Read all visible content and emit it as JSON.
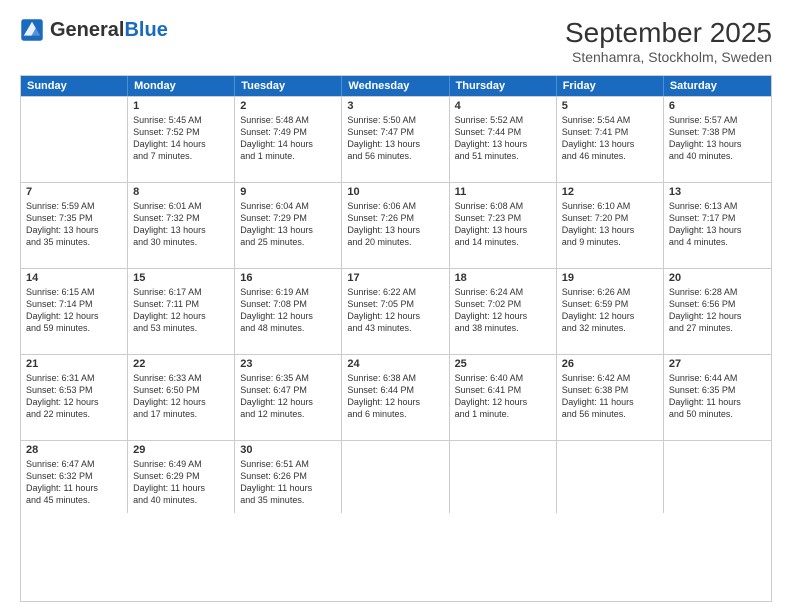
{
  "header": {
    "logo_line1": "General",
    "logo_line2": "Blue",
    "title": "September 2025",
    "subtitle": "Stenhamra, Stockholm, Sweden"
  },
  "weekdays": [
    "Sunday",
    "Monday",
    "Tuesday",
    "Wednesday",
    "Thursday",
    "Friday",
    "Saturday"
  ],
  "weeks": [
    [
      {
        "day": "",
        "lines": []
      },
      {
        "day": "1",
        "lines": [
          "Sunrise: 5:45 AM",
          "Sunset: 7:52 PM",
          "Daylight: 14 hours",
          "and 7 minutes."
        ]
      },
      {
        "day": "2",
        "lines": [
          "Sunrise: 5:48 AM",
          "Sunset: 7:49 PM",
          "Daylight: 14 hours",
          "and 1 minute."
        ]
      },
      {
        "day": "3",
        "lines": [
          "Sunrise: 5:50 AM",
          "Sunset: 7:47 PM",
          "Daylight: 13 hours",
          "and 56 minutes."
        ]
      },
      {
        "day": "4",
        "lines": [
          "Sunrise: 5:52 AM",
          "Sunset: 7:44 PM",
          "Daylight: 13 hours",
          "and 51 minutes."
        ]
      },
      {
        "day": "5",
        "lines": [
          "Sunrise: 5:54 AM",
          "Sunset: 7:41 PM",
          "Daylight: 13 hours",
          "and 46 minutes."
        ]
      },
      {
        "day": "6",
        "lines": [
          "Sunrise: 5:57 AM",
          "Sunset: 7:38 PM",
          "Daylight: 13 hours",
          "and 40 minutes."
        ]
      }
    ],
    [
      {
        "day": "7",
        "lines": [
          "Sunrise: 5:59 AM",
          "Sunset: 7:35 PM",
          "Daylight: 13 hours",
          "and 35 minutes."
        ]
      },
      {
        "day": "8",
        "lines": [
          "Sunrise: 6:01 AM",
          "Sunset: 7:32 PM",
          "Daylight: 13 hours",
          "and 30 minutes."
        ]
      },
      {
        "day": "9",
        "lines": [
          "Sunrise: 6:04 AM",
          "Sunset: 7:29 PM",
          "Daylight: 13 hours",
          "and 25 minutes."
        ]
      },
      {
        "day": "10",
        "lines": [
          "Sunrise: 6:06 AM",
          "Sunset: 7:26 PM",
          "Daylight: 13 hours",
          "and 20 minutes."
        ]
      },
      {
        "day": "11",
        "lines": [
          "Sunrise: 6:08 AM",
          "Sunset: 7:23 PM",
          "Daylight: 13 hours",
          "and 14 minutes."
        ]
      },
      {
        "day": "12",
        "lines": [
          "Sunrise: 6:10 AM",
          "Sunset: 7:20 PM",
          "Daylight: 13 hours",
          "and 9 minutes."
        ]
      },
      {
        "day": "13",
        "lines": [
          "Sunrise: 6:13 AM",
          "Sunset: 7:17 PM",
          "Daylight: 13 hours",
          "and 4 minutes."
        ]
      }
    ],
    [
      {
        "day": "14",
        "lines": [
          "Sunrise: 6:15 AM",
          "Sunset: 7:14 PM",
          "Daylight: 12 hours",
          "and 59 minutes."
        ]
      },
      {
        "day": "15",
        "lines": [
          "Sunrise: 6:17 AM",
          "Sunset: 7:11 PM",
          "Daylight: 12 hours",
          "and 53 minutes."
        ]
      },
      {
        "day": "16",
        "lines": [
          "Sunrise: 6:19 AM",
          "Sunset: 7:08 PM",
          "Daylight: 12 hours",
          "and 48 minutes."
        ]
      },
      {
        "day": "17",
        "lines": [
          "Sunrise: 6:22 AM",
          "Sunset: 7:05 PM",
          "Daylight: 12 hours",
          "and 43 minutes."
        ]
      },
      {
        "day": "18",
        "lines": [
          "Sunrise: 6:24 AM",
          "Sunset: 7:02 PM",
          "Daylight: 12 hours",
          "and 38 minutes."
        ]
      },
      {
        "day": "19",
        "lines": [
          "Sunrise: 6:26 AM",
          "Sunset: 6:59 PM",
          "Daylight: 12 hours",
          "and 32 minutes."
        ]
      },
      {
        "day": "20",
        "lines": [
          "Sunrise: 6:28 AM",
          "Sunset: 6:56 PM",
          "Daylight: 12 hours",
          "and 27 minutes."
        ]
      }
    ],
    [
      {
        "day": "21",
        "lines": [
          "Sunrise: 6:31 AM",
          "Sunset: 6:53 PM",
          "Daylight: 12 hours",
          "and 22 minutes."
        ]
      },
      {
        "day": "22",
        "lines": [
          "Sunrise: 6:33 AM",
          "Sunset: 6:50 PM",
          "Daylight: 12 hours",
          "and 17 minutes."
        ]
      },
      {
        "day": "23",
        "lines": [
          "Sunrise: 6:35 AM",
          "Sunset: 6:47 PM",
          "Daylight: 12 hours",
          "and 12 minutes."
        ]
      },
      {
        "day": "24",
        "lines": [
          "Sunrise: 6:38 AM",
          "Sunset: 6:44 PM",
          "Daylight: 12 hours",
          "and 6 minutes."
        ]
      },
      {
        "day": "25",
        "lines": [
          "Sunrise: 6:40 AM",
          "Sunset: 6:41 PM",
          "Daylight: 12 hours",
          "and 1 minute."
        ]
      },
      {
        "day": "26",
        "lines": [
          "Sunrise: 6:42 AM",
          "Sunset: 6:38 PM",
          "Daylight: 11 hours",
          "and 56 minutes."
        ]
      },
      {
        "day": "27",
        "lines": [
          "Sunrise: 6:44 AM",
          "Sunset: 6:35 PM",
          "Daylight: 11 hours",
          "and 50 minutes."
        ]
      }
    ],
    [
      {
        "day": "28",
        "lines": [
          "Sunrise: 6:47 AM",
          "Sunset: 6:32 PM",
          "Daylight: 11 hours",
          "and 45 minutes."
        ]
      },
      {
        "day": "29",
        "lines": [
          "Sunrise: 6:49 AM",
          "Sunset: 6:29 PM",
          "Daylight: 11 hours",
          "and 40 minutes."
        ]
      },
      {
        "day": "30",
        "lines": [
          "Sunrise: 6:51 AM",
          "Sunset: 6:26 PM",
          "Daylight: 11 hours",
          "and 35 minutes."
        ]
      },
      {
        "day": "",
        "lines": []
      },
      {
        "day": "",
        "lines": []
      },
      {
        "day": "",
        "lines": []
      },
      {
        "day": "",
        "lines": []
      }
    ]
  ]
}
